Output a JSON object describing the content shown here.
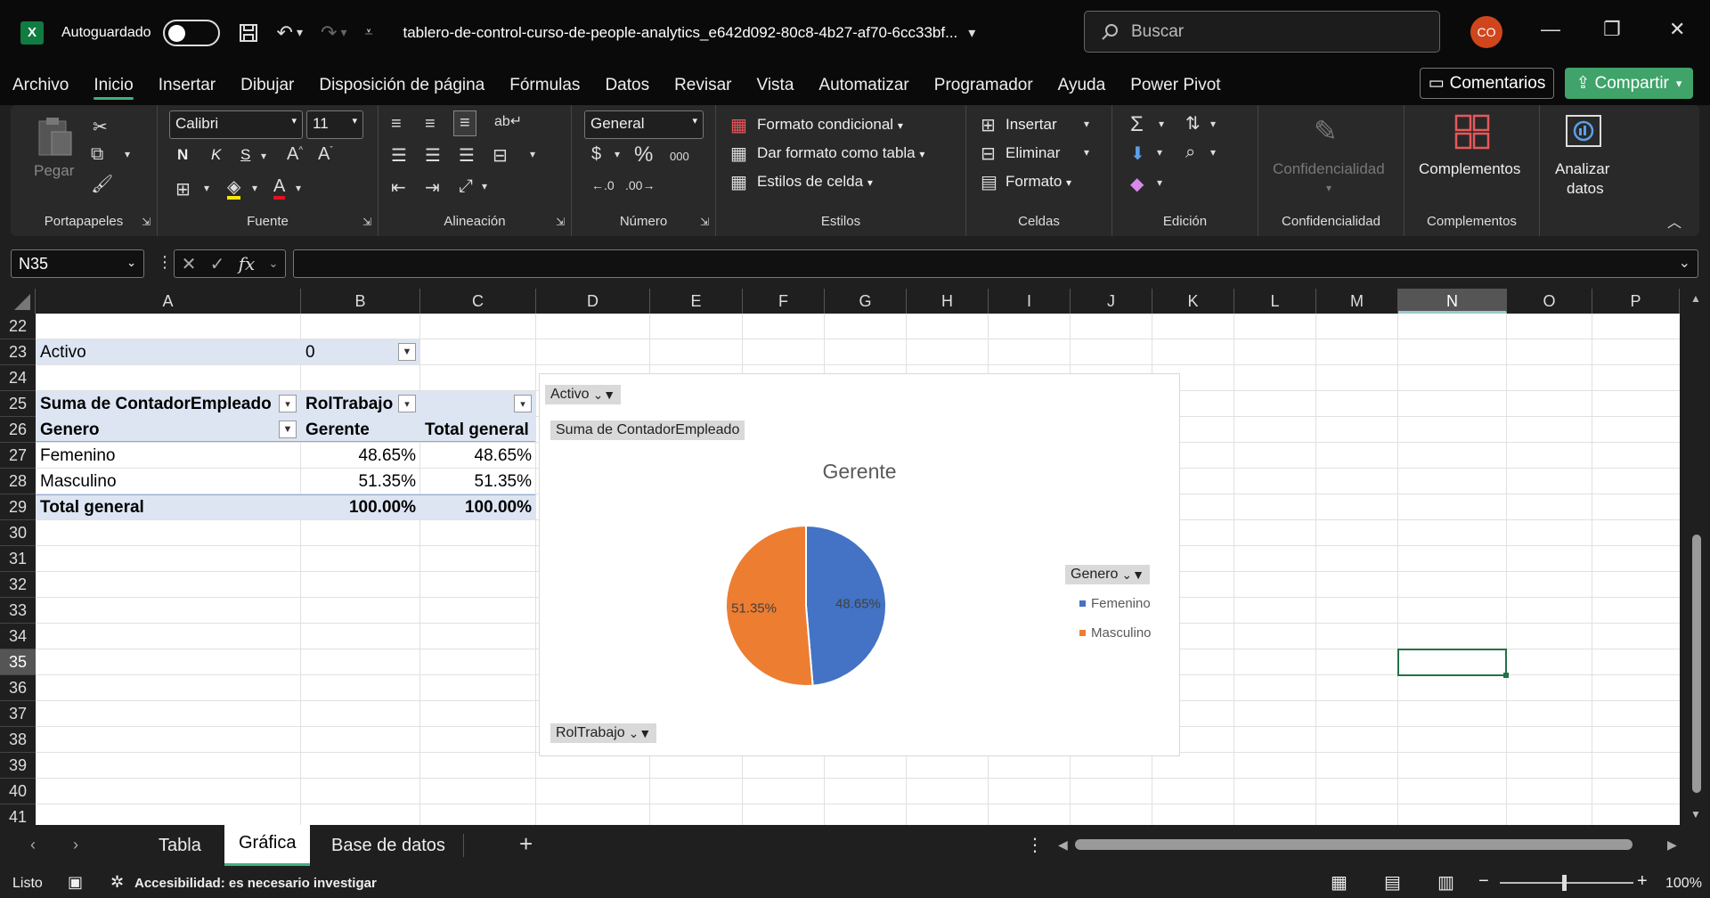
{
  "title_bar": {
    "app_icon": "X",
    "autosave_label": "Autoguardado",
    "document_title": "tablero-de-control-curso-de-people-analytics_e642d092-80c8-4b27-af70-6cc33bf...",
    "search_placeholder": "Buscar",
    "avatar_initials": "CO"
  },
  "menu": [
    "Archivo",
    "Inicio",
    "Insertar",
    "Dibujar",
    "Disposición de página",
    "Fórmulas",
    "Datos",
    "Revisar",
    "Vista",
    "Automatizar",
    "Programador",
    "Ayuda",
    "Power Pivot"
  ],
  "menu_active": "Inicio",
  "buttons": {
    "comments": "Comentarios",
    "share": "Compartir"
  },
  "ribbon": {
    "groups": {
      "clipboard": "Portapapeles",
      "font": "Fuente",
      "alignment": "Alineación",
      "number": "Número",
      "styles": "Estilos",
      "cells": "Celdas",
      "editing": "Edición",
      "sensitivity": "Confidencialidad",
      "addins": "Complementos"
    },
    "paste": "Pegar",
    "font_name": "Calibri",
    "font_size": "11",
    "bold": "N",
    "italic": "K",
    "underline": "S",
    "number_format": "General",
    "conditional_format": "Formato condicional",
    "format_as_table": "Dar formato como tabla",
    "cell_styles": "Estilos de celda",
    "insert": "Insertar",
    "delete": "Eliminar",
    "format": "Formato",
    "sensitivity_btn": "Confidencialidad",
    "addins_btn": "Complementos",
    "analyze_line1": "Analizar",
    "analyze_line2": "datos"
  },
  "formula_bar": {
    "name_box": "N35",
    "fx": "fx",
    "formula": ""
  },
  "columns": [
    "A",
    "B",
    "C",
    "D",
    "E",
    "F",
    "G",
    "H",
    "I",
    "J",
    "K",
    "L",
    "M",
    "N",
    "O",
    "P"
  ],
  "selected_column": "N",
  "rows": [
    "22",
    "23",
    "24",
    "25",
    "26",
    "27",
    "28",
    "29",
    "30",
    "31",
    "32",
    "33",
    "34",
    "35",
    "36",
    "37",
    "38",
    "39",
    "40",
    "41"
  ],
  "selected_row": "35",
  "pivot": {
    "filter_label": "Activo",
    "filter_value": "0",
    "header_values": "Suma de ContadorEmpleado",
    "header_columns": "RolTrabajo",
    "row_label": "Genero",
    "col_gerente": "Gerente",
    "col_total": "Total general",
    "rows": [
      {
        "label": "Femenino",
        "gerente": "48.65%",
        "total": "48.65%"
      },
      {
        "label": "Masculino",
        "gerente": "51.35%",
        "total": "51.35%"
      }
    ],
    "grand_total": {
      "label": "Total general",
      "gerente": "100.00%",
      "total": "100.00%"
    }
  },
  "chart_buttons": {
    "filter": "Activo",
    "values": "Suma de ContadorEmpleado",
    "axis": "RolTrabajo",
    "legend_title": "Genero"
  },
  "chart_data": {
    "type": "pie",
    "title": "Gerente",
    "categories": [
      "Femenino",
      "Masculino"
    ],
    "values": [
      48.65,
      51.35
    ],
    "data_labels": [
      "48.65%",
      "51.35%"
    ],
    "colors": [
      "#4472c4",
      "#ed7d31"
    ],
    "legend_position": "right"
  },
  "sheet_tabs": [
    "Tabla",
    "Gráfica",
    "Base de datos"
  ],
  "active_tab": "Gráfica",
  "status": {
    "ready": "Listo",
    "accessibility": "Accesibilidad: es necesario investigar",
    "zoom": "100%"
  }
}
